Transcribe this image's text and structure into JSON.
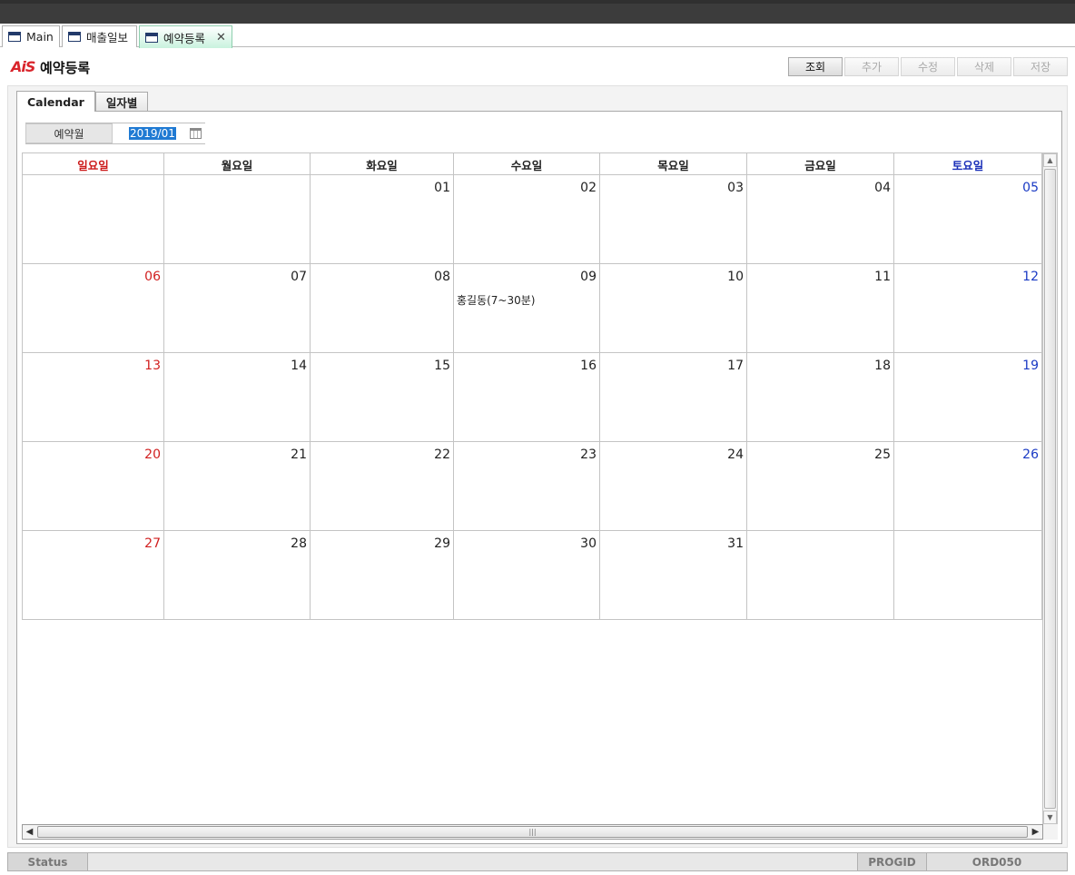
{
  "doc_tabs": [
    {
      "label": "Main",
      "active": false
    },
    {
      "label": "매출일보",
      "active": false
    },
    {
      "label": "예약등록",
      "active": true
    }
  ],
  "logo_text": "AiS",
  "page_title": "예약등록",
  "toolbar": {
    "search_label": "조회",
    "add_label": "추가",
    "edit_label": "수정",
    "delete_label": "삭제",
    "save_label": "저장"
  },
  "inner_tabs": [
    {
      "label": "Calendar",
      "active": true
    },
    {
      "label": "일자별",
      "active": false
    }
  ],
  "filter": {
    "label": "예약월",
    "value": "2019/01"
  },
  "calendar": {
    "weekdays": [
      "일요일",
      "월요일",
      "화요일",
      "수요일",
      "목요일",
      "금요일",
      "토요일"
    ],
    "weeks": [
      [
        "",
        "",
        "01",
        "02",
        "03",
        "04",
        "05"
      ],
      [
        "06",
        "07",
        "08",
        "09",
        "10",
        "11",
        "12"
      ],
      [
        "13",
        "14",
        "15",
        "16",
        "17",
        "18",
        "19"
      ],
      [
        "20",
        "21",
        "22",
        "23",
        "24",
        "25",
        "26"
      ],
      [
        "27",
        "28",
        "29",
        "30",
        "31",
        "",
        ""
      ]
    ],
    "events": [
      {
        "day": "09",
        "text": "홍길동(7~30분)"
      }
    ],
    "colors": {
      "sunday": "#d12020",
      "saturday": "#1a3ac4"
    }
  },
  "status_bar": {
    "status_label": "Status",
    "status_text": "",
    "progid_label": "PROGID",
    "progid_value": "ORD050"
  }
}
